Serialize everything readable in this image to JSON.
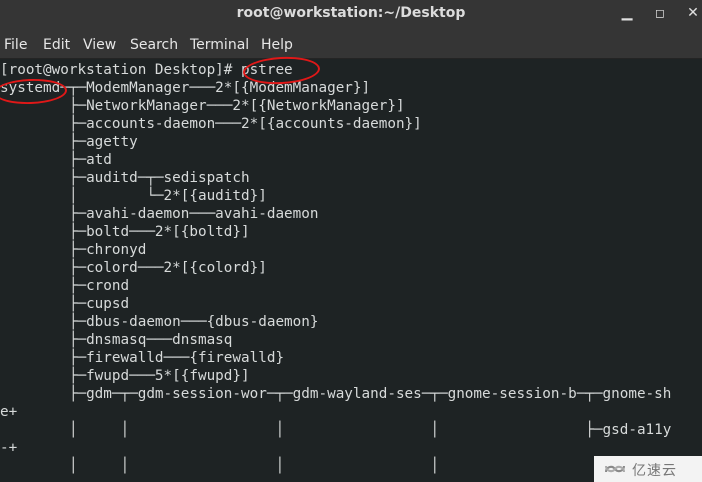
{
  "window": {
    "title": "root@workstation:~/Desktop",
    "controls": {
      "minimize_icon": "minimize-icon",
      "maximize_icon": "maximize-icon",
      "close_icon": "close-icon"
    }
  },
  "menu": {
    "items": [
      "File",
      "Edit",
      "View",
      "Search",
      "Terminal",
      "Help"
    ]
  },
  "terminal": {
    "lines": [
      "[root@workstation Desktop]# pstree",
      "systemd─┬─ModemManager───2*[{ModemManager}]",
      "        ├─NetworkManager───2*[{NetworkManager}]",
      "        ├─accounts-daemon───2*[{accounts-daemon}]",
      "        ├─agetty",
      "        ├─atd",
      "        ├─auditd─┬─sedispatch",
      "        │        └─2*[{auditd}]",
      "        ├─avahi-daemon───avahi-daemon",
      "        ├─boltd───2*[{boltd}]",
      "        ├─chronyd",
      "        ├─colord───2*[{colord}]",
      "        ├─crond",
      "        ├─cupsd",
      "        ├─dbus-daemon───{dbus-daemon}",
      "        ├─dnsmasq───dnsmasq",
      "        ├─firewalld───{firewalld}",
      "        ├─fwupd───5*[{fwupd}]",
      "        ├─gdm─┬─gdm-session-wor─┬─gdm-wayland-ses─┬─gnome-session-b─┬─gnome-sh",
      "e+",
      "        │     │                 │                 │                 ├─gsd-a11y",
      "-+",
      "        │     │                 │                 │"
    ]
  },
  "watermark": {
    "icon": "yisu-cloud-logo-icon",
    "text": "亿速云"
  }
}
